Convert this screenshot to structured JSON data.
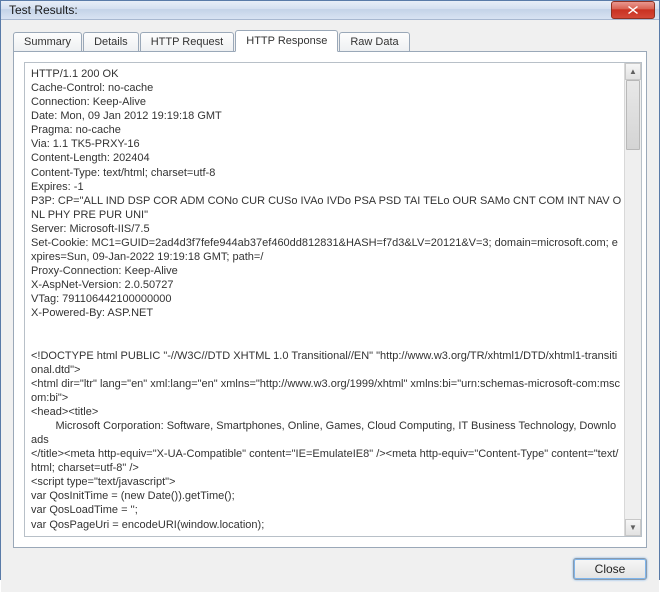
{
  "window": {
    "title": "Test Results:"
  },
  "tabs": [
    {
      "label": "Summary"
    },
    {
      "label": "Details"
    },
    {
      "label": "HTTP Request"
    },
    {
      "label": "HTTP Response"
    },
    {
      "label": "Raw Data"
    }
  ],
  "active_tab_index": 3,
  "response_text": "HTTP/1.1 200 OK\nCache-Control: no-cache\nConnection: Keep-Alive\nDate: Mon, 09 Jan 2012 19:19:18 GMT\nPragma: no-cache\nVia: 1.1 TK5-PRXY-16\nContent-Length: 202404\nContent-Type: text/html; charset=utf-8\nExpires: -1\nP3P: CP=\"ALL IND DSP COR ADM CONo CUR CUSo IVAo IVDo PSA PSD TAI TELo OUR SAMo CNT COM INT NAV ONL PHY PRE PUR UNI\"\nServer: Microsoft-IIS/7.5\nSet-Cookie: MC1=GUID=2ad4d3f7fefe944ab37ef460dd812831&HASH=f7d3&LV=20121&V=3; domain=microsoft.com; expires=Sun, 09-Jan-2022 19:19:18 GMT; path=/\nProxy-Connection: Keep-Alive\nX-AspNet-Version: 2.0.50727\nVTag: 791106442100000000\nX-Powered-By: ASP.NET\n\n\n<!DOCTYPE html PUBLIC \"-//W3C//DTD XHTML 1.0 Transitional//EN\" \"http://www.w3.org/TR/xhtml1/DTD/xhtml1-transitional.dtd\">\n<html dir=\"ltr\" lang=\"en\" xml:lang=\"en\" xmlns=\"http://www.w3.org/1999/xhtml\" xmlns:bi=\"urn:schemas-microsoft-com:mscom:bi\">\n<head><title>\n\tMicrosoft Corporation: Software, Smartphones, Online, Games, Cloud Computing, IT Business Technology, Downloads\n</title><meta http-equiv=\"X-UA-Compatible\" content=\"IE=EmulateIE8\" /><meta http-equiv=\"Content-Type\" content=\"text/html; charset=utf-8\" />\n<script type=\"text/javascript\">\nvar QosInitTime = (new Date()).getTime();\nvar QosLoadTime = '';\nvar QosPageUri = encodeURI(window.location);",
  "footer": {
    "close_label": "Close"
  }
}
